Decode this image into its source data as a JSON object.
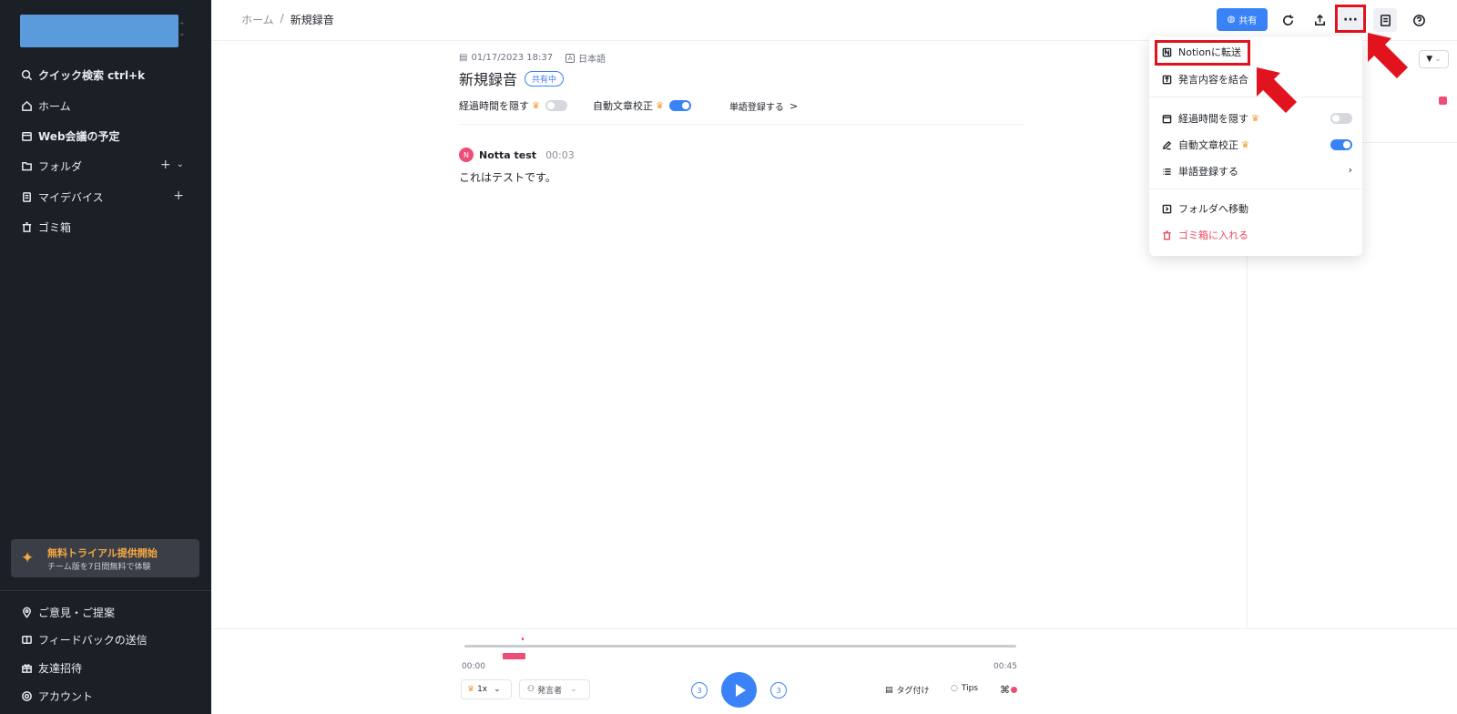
{
  "sidebar": {
    "nav": [
      {
        "label": "クイック検索 ctrl+k",
        "icon": "search-icon"
      },
      {
        "label": "ホーム",
        "icon": "home-icon"
      },
      {
        "label": "Web会議の予定",
        "icon": "calendar-icon"
      },
      {
        "label": "フォルダ",
        "icon": "folder-icon"
      },
      {
        "label": "マイデバイス",
        "icon": "device-icon"
      },
      {
        "label": "ゴミ箱",
        "icon": "trash-icon"
      }
    ],
    "trial": {
      "title": "無料トライアル提供開始",
      "subtitle": "チーム版を7日間無料で体験"
    },
    "footer": [
      {
        "label": "ご意見・ご提案",
        "icon": "location-pin-icon"
      },
      {
        "label": "フィードバックの送信",
        "icon": "book-icon"
      },
      {
        "label": "友達招待",
        "icon": "gift-icon"
      },
      {
        "label": "アカウント",
        "icon": "settings-icon"
      }
    ]
  },
  "breadcrumb": {
    "home": "ホーム",
    "separator": "/",
    "current": "新規録音"
  },
  "toolbar": {
    "share_label": "共有",
    "more_label": "···"
  },
  "record": {
    "date": "01/17/2023 18:37",
    "language": "日本語",
    "title": "新規録音",
    "status_badge": "共有中",
    "opt_hide_time": "経過時間を隠す",
    "opt_autocorrect": "自動文章校正",
    "opt_vocab": "単語登録する",
    "chevron": ">"
  },
  "transcript": {
    "speaker_initial": "N",
    "speaker_name": "Notta test",
    "time": "00:03",
    "text": "これはテストです。"
  },
  "dropdown": {
    "items": [
      {
        "label": "Notionに転送"
      },
      {
        "label": "発言内容を結合"
      },
      {
        "label": "経過時間を隠す",
        "toggle": false
      },
      {
        "label": "自動文章校正",
        "toggle": true
      },
      {
        "label": "単語登録する"
      },
      {
        "label": "フォルダへ移動"
      },
      {
        "label": "ゴミ箱に入れる"
      }
    ]
  },
  "player": {
    "time_start": "00:00",
    "time_end": "00:45",
    "speed": "1x",
    "speaker_filter": "発言者",
    "skip_back": "3",
    "skip_forward": "3",
    "tag_label": "タグ付け",
    "tips_label": "Tips"
  },
  "colors": {
    "accent": "#3a82f7",
    "sidebar_bg": "#1b1f26",
    "highlight_red": "#e0131f",
    "speaker_pink": "#ee4d77"
  }
}
